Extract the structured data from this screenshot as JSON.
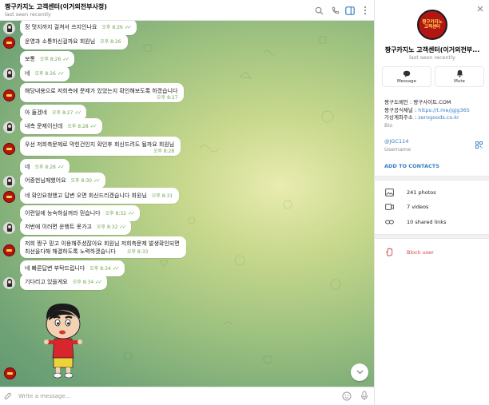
{
  "chat": {
    "title": "짱구카지노 고객센터(이거외전부사정)",
    "status": "last seen recently",
    "composer_placeholder": "Write a message..."
  },
  "messages": [
    {
      "sender": "user",
      "text": "정 멋지까지 걸쳐서 쓰지인나요",
      "time": "오후 8:26"
    },
    {
      "sender": "agent",
      "text": "운영과 소통하신걸까요 회원님",
      "time": "오후 8:26"
    },
    {
      "sender": "user",
      "text": "보통",
      "time": "오후 8:26"
    },
    {
      "sender": "user",
      "text": "네",
      "time": "오후 8:26"
    },
    {
      "sender": "agent",
      "text": "해당내용으로 저희측에 문제가 있었는지 확인해보도록 하겠습니다",
      "time": "오후 8:27"
    },
    {
      "sender": "user",
      "text": "아 들겠네",
      "time": "오후 8:27"
    },
    {
      "sender": "user",
      "text": "내측 문제이신데",
      "time": "오후 8:28"
    },
    {
      "sender": "agent",
      "text": "우선 저희측문제로 막힌건인지 확인후 회신드려도 될까요 회원님",
      "time": "오후 8:28"
    },
    {
      "sender": "user",
      "text": "네",
      "time": "오후 8:28"
    },
    {
      "sender": "user",
      "text": "어중헌님께했어요",
      "time": "오후 8:30"
    },
    {
      "sender": "agent",
      "text": "네 확인요청했고 답변 오면 회신드리겠습니다 회원님",
      "time": "오후 8:31"
    },
    {
      "sender": "user",
      "text": "이런일에 능숙하실꺼라 믿습니다",
      "time": "오후 8:32"
    },
    {
      "sender": "user",
      "text": "저번에 이러면 운행트 못가고",
      "time": "오후 8:32"
    },
    {
      "sender": "agent",
      "text": "저희 짱구 믿고 이용해주셨잖아요 회원님 저희측문제 발생확인되면",
      "text2": "최선을다해 해결하도록 노력하겠습니다",
      "time": "오후 8:33"
    },
    {
      "sender": "user",
      "text": "네 빠른답변 부탁드립니다",
      "time": "오후 8:34"
    },
    {
      "sender": "user",
      "text": "기다리고 있을게요",
      "time": "오후 8:34"
    }
  ],
  "panel": {
    "name": "짱구카지노 고객센터(이거외전부...",
    "status": "last seen recently",
    "avatar_logo_text": [
      "짱구카지노",
      "고객센터"
    ],
    "message_label": "Message",
    "mute_label": "Mute",
    "bio_lines": [
      {
        "label": "짱구도메인 : ",
        "value": "짱구사이트.COM"
      },
      {
        "label": "짱구공식채널 : ",
        "value": "https://t.me/jgjg365"
      },
      {
        "label": "가상계좌주소 : ",
        "value": "zerogoods.co.kr"
      }
    ],
    "bio_caption": "Bio",
    "username": "@JGC114",
    "username_caption": "Username",
    "add_to_contacts": "ADD TO CONTACTS",
    "photos": "241 photos",
    "videos": "7 videos",
    "links": "10 shared links",
    "block": "Block user"
  },
  "colors": {
    "accent_blue": "#3a7fc0",
    "check_green": "#5fb55a",
    "danger_red": "#d04a48",
    "chat_bg_center": "#e9ecb0",
    "chat_bg_edge": "#629870"
  }
}
